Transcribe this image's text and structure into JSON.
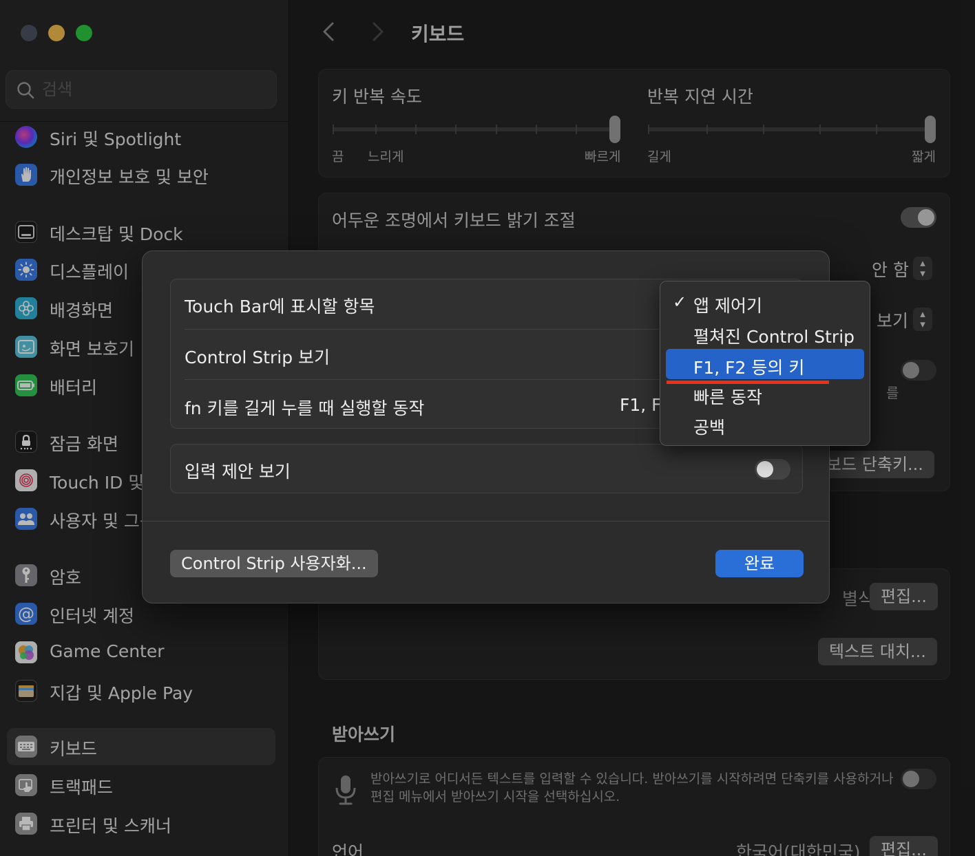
{
  "window": {
    "title": "키보드"
  },
  "search": {
    "placeholder": "검색"
  },
  "sidebar": {
    "items": [
      {
        "label": "Siri 및 Spotlight",
        "icon": "siri-icon"
      },
      {
        "label": "개인정보 보호 및 보안",
        "icon": "hand-icon"
      },
      {
        "label": "데스크탑 및 Dock",
        "icon": "dock-icon"
      },
      {
        "label": "디스플레이",
        "icon": "sun-icon"
      },
      {
        "label": "배경화면",
        "icon": "flower-icon"
      },
      {
        "label": "화면 보호기",
        "icon": "screensaver-icon"
      },
      {
        "label": "배터리",
        "icon": "battery-icon"
      },
      {
        "label": "잠금 화면",
        "icon": "lock-icon"
      },
      {
        "label": "Touch ID 및",
        "icon": "fingerprint-icon"
      },
      {
        "label": "사용자 및 그룹",
        "icon": "users-icon"
      },
      {
        "label": "암호",
        "icon": "key-icon"
      },
      {
        "label": "인터넷 계정",
        "icon": "at-icon"
      },
      {
        "label": "Game Center",
        "icon": "gamecenter-icon"
      },
      {
        "label": "지갑 및 Apple Pay",
        "icon": "wallet-icon"
      },
      {
        "label": "키보드",
        "icon": "keyboard-icon"
      },
      {
        "label": "트랙패드",
        "icon": "trackpad-icon"
      },
      {
        "label": "프린터 및 스캐너",
        "icon": "printer-icon"
      }
    ]
  },
  "keyboard": {
    "repeat_rate_label": "키 반복 속도",
    "repeat_rate_off": "끔",
    "repeat_rate_slow": "느리게",
    "repeat_rate_fast": "빠르게",
    "repeat_rate_value": 1.0,
    "delay_label": "반복 지연 시간",
    "delay_long": "길게",
    "delay_short": "짧게",
    "delay_value": 1.0,
    "backlight_label": "어두운 조명에서 키보드 밝기 조절",
    "backlight_on": true,
    "row2_value": "안 함",
    "row3_value": "보기",
    "row5_partial": "를",
    "shortcuts_button": "보드 단축키...",
    "input_sources_partial": "별식",
    "edit_button": "편집...",
    "text_replacements_button": "텍스트 대치...",
    "dictation_title": "받아쓰기",
    "dictation_desc_line1": "받아쓰기로 어디서든 텍스트를 입력할 수 있습니다. 받아쓰기를 시작하려면 단축키를 사용하거나",
    "dictation_desc_line2": "편집 메뉴에서 받아쓰기 시작을 선택하십시오.",
    "dictation_on": false,
    "language_label": "언어",
    "language_value": "한국어(대한민국)",
    "language_edit": "편집..."
  },
  "dialog": {
    "touchbar_label": "Touch Bar에 표시할 항목",
    "control_strip_label": "Control Strip 보기",
    "fn_label": "fn 키를 길게 누를 때 실행할 동작",
    "fn_value": "F1, F",
    "typing_suggestions_label": "입력 제안 보기",
    "typing_suggestions_on": false,
    "customize_button": "Control Strip 사용자화...",
    "done_button": "완료"
  },
  "popup_menu": {
    "items": [
      {
        "label": "앱 제어기",
        "checked": true
      },
      {
        "label": "펼쳐진 Control Strip",
        "checked": false
      },
      {
        "label": "F1, F2 등의 키",
        "checked": false,
        "highlighted": true
      },
      {
        "label": "빠른 동작",
        "checked": false
      },
      {
        "label": "공백",
        "checked": false
      }
    ],
    "check_glyph": "✓"
  },
  "colors": {
    "accent": "#2a6ed7",
    "menu_highlight": "#2563c9",
    "annotation_underline": "#e8301c"
  }
}
